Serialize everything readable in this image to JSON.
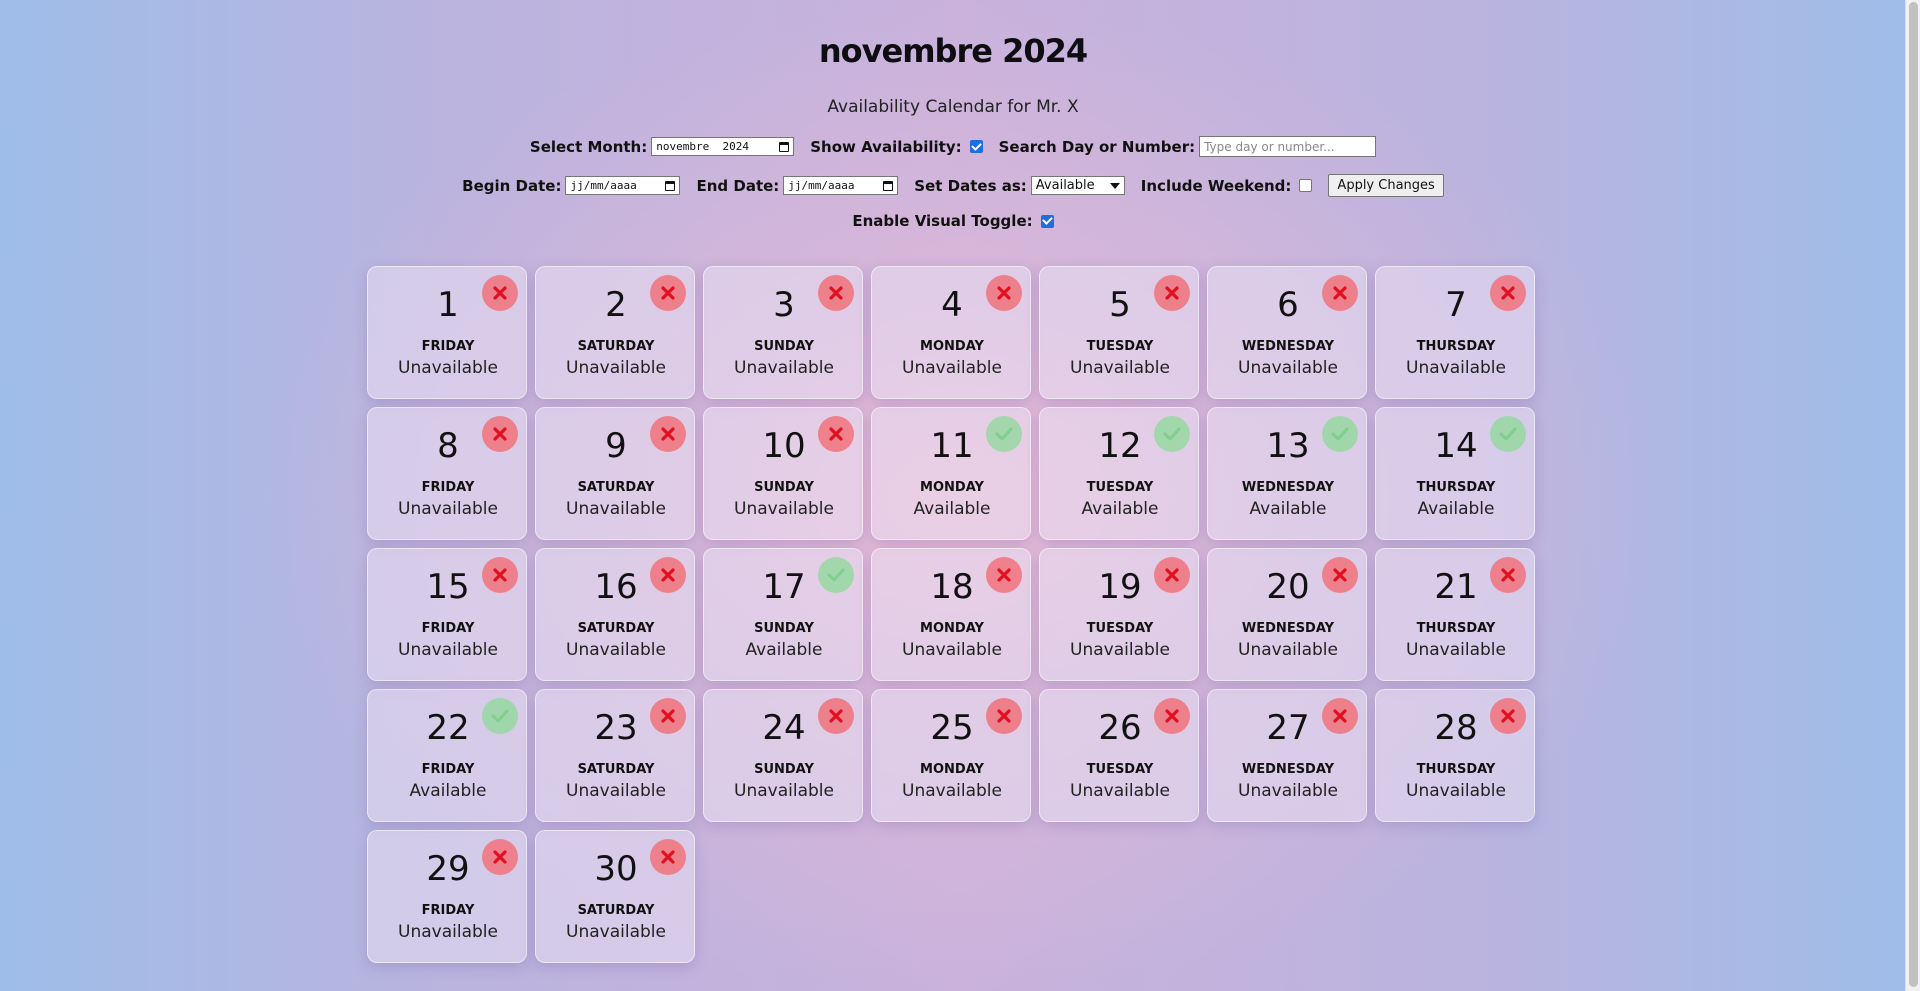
{
  "header": {
    "title": "novembre 2024",
    "subtitle": "Availability Calendar for Mr. X"
  },
  "controls": {
    "select_month_label": "Select Month:",
    "select_month_value": "novembre  2024",
    "show_availability_label": "Show Availability:",
    "show_availability_checked": true,
    "search_label": "Search Day or Number:",
    "search_placeholder": "Type day or number...",
    "begin_date_label": "Begin Date:",
    "begin_date_value": "jj/mm/aaaa",
    "end_date_label": "End Date:",
    "end_date_value": "jj/mm/aaaa",
    "set_dates_label": "Set Dates as:",
    "set_dates_value": "Available",
    "include_weekend_label": "Include Weekend:",
    "include_weekend_checked": false,
    "apply_label": "Apply Changes",
    "visual_toggle_label": "Enable Visual Toggle:",
    "visual_toggle_checked": true
  },
  "colors": {
    "unavailable_badge": "#f0787f",
    "available_badge": "#96d7a0",
    "checkbox_accent": "#1b6fe0"
  },
  "days": [
    {
      "day": "1",
      "weekday": "FRIDAY",
      "status": "Unavailable",
      "icon": "close-icon"
    },
    {
      "day": "2",
      "weekday": "SATURDAY",
      "status": "Unavailable",
      "icon": "close-icon"
    },
    {
      "day": "3",
      "weekday": "SUNDAY",
      "status": "Unavailable",
      "icon": "close-icon"
    },
    {
      "day": "4",
      "weekday": "MONDAY",
      "status": "Unavailable",
      "icon": "close-icon"
    },
    {
      "day": "5",
      "weekday": "TUESDAY",
      "status": "Unavailable",
      "icon": "close-icon"
    },
    {
      "day": "6",
      "weekday": "WEDNESDAY",
      "status": "Unavailable",
      "icon": "close-icon"
    },
    {
      "day": "7",
      "weekday": "THURSDAY",
      "status": "Unavailable",
      "icon": "close-icon"
    },
    {
      "day": "8",
      "weekday": "FRIDAY",
      "status": "Unavailable",
      "icon": "close-icon"
    },
    {
      "day": "9",
      "weekday": "SATURDAY",
      "status": "Unavailable",
      "icon": "close-icon"
    },
    {
      "day": "10",
      "weekday": "SUNDAY",
      "status": "Unavailable",
      "icon": "close-icon"
    },
    {
      "day": "11",
      "weekday": "MONDAY",
      "status": "Available",
      "icon": "check-icon"
    },
    {
      "day": "12",
      "weekday": "TUESDAY",
      "status": "Available",
      "icon": "check-icon"
    },
    {
      "day": "13",
      "weekday": "WEDNESDAY",
      "status": "Available",
      "icon": "check-icon"
    },
    {
      "day": "14",
      "weekday": "THURSDAY",
      "status": "Available",
      "icon": "check-icon"
    },
    {
      "day": "15",
      "weekday": "FRIDAY",
      "status": "Unavailable",
      "icon": "close-icon"
    },
    {
      "day": "16",
      "weekday": "SATURDAY",
      "status": "Unavailable",
      "icon": "close-icon"
    },
    {
      "day": "17",
      "weekday": "SUNDAY",
      "status": "Available",
      "icon": "check-icon"
    },
    {
      "day": "18",
      "weekday": "MONDAY",
      "status": "Unavailable",
      "icon": "close-icon"
    },
    {
      "day": "19",
      "weekday": "TUESDAY",
      "status": "Unavailable",
      "icon": "close-icon"
    },
    {
      "day": "20",
      "weekday": "WEDNESDAY",
      "status": "Unavailable",
      "icon": "close-icon"
    },
    {
      "day": "21",
      "weekday": "THURSDAY",
      "status": "Unavailable",
      "icon": "close-icon"
    },
    {
      "day": "22",
      "weekday": "FRIDAY",
      "status": "Available",
      "icon": "check-icon"
    },
    {
      "day": "23",
      "weekday": "SATURDAY",
      "status": "Unavailable",
      "icon": "close-icon"
    },
    {
      "day": "24",
      "weekday": "SUNDAY",
      "status": "Unavailable",
      "icon": "close-icon"
    },
    {
      "day": "25",
      "weekday": "MONDAY",
      "status": "Unavailable",
      "icon": "close-icon"
    },
    {
      "day": "26",
      "weekday": "TUESDAY",
      "status": "Unavailable",
      "icon": "close-icon"
    },
    {
      "day": "27",
      "weekday": "WEDNESDAY",
      "status": "Unavailable",
      "icon": "close-icon"
    },
    {
      "day": "28",
      "weekday": "THURSDAY",
      "status": "Unavailable",
      "icon": "close-icon"
    },
    {
      "day": "29",
      "weekday": "FRIDAY",
      "status": "Unavailable",
      "icon": "close-icon"
    },
    {
      "day": "30",
      "weekday": "SATURDAY",
      "status": "Unavailable",
      "icon": "close-icon"
    }
  ]
}
